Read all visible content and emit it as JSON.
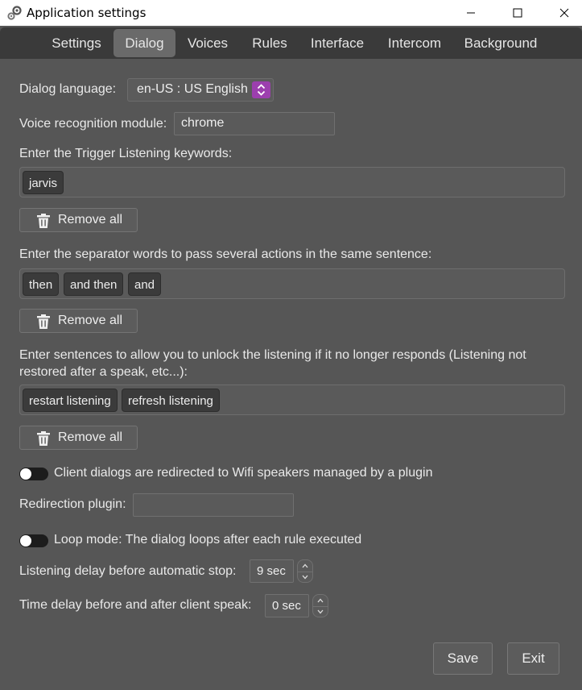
{
  "window": {
    "title": "Application settings",
    "icon": "settings-gear-icon"
  },
  "tabs": [
    {
      "label": "Settings",
      "active": false
    },
    {
      "label": "Dialog",
      "active": true
    },
    {
      "label": "Voices",
      "active": false
    },
    {
      "label": "Rules",
      "active": false
    },
    {
      "label": "Interface",
      "active": false
    },
    {
      "label": "Intercom",
      "active": false
    },
    {
      "label": "Background",
      "active": false
    }
  ],
  "dialog": {
    "language_label": "Dialog language:",
    "language_value": "en-US : US English",
    "recognition_label": "Voice recognition module:",
    "recognition_value": "chrome",
    "trigger_label": "Enter the Trigger Listening keywords:",
    "trigger_tags": [
      "jarvis"
    ],
    "separator_label": "Enter the separator words to pass several actions in the same sentence:",
    "separator_tags": [
      "then",
      "and then",
      "and"
    ],
    "unlock_label_line1": "Enter sentences to allow you to unlock the listening if it no longer responds (Listening not",
    "unlock_label_line2": "restored after a speak, etc...):",
    "unlock_tags": [
      "restart listening",
      "refresh listening"
    ],
    "remove_all_label": "Remove all",
    "redirect_toggle_label": "Client dialogs are redirected to Wifi speakers managed by a plugin",
    "redirect_toggle_on": false,
    "redirect_plugin_label": "Redirection plugin:",
    "redirect_plugin_value": "",
    "loop_toggle_label": "Loop mode: The dialog loops after each rule executed",
    "loop_toggle_on": false,
    "listen_delay_label": "Listening delay before automatic stop:",
    "listen_delay_value": "9 sec",
    "speak_delay_label": "Time delay before and after client speak:",
    "speak_delay_value": "0 sec"
  },
  "footer": {
    "save_label": "Save",
    "exit_label": "Exit"
  },
  "colors": {
    "background": "#565656",
    "tabbar": "#3a3a3a",
    "accent": "#9c3fae"
  }
}
